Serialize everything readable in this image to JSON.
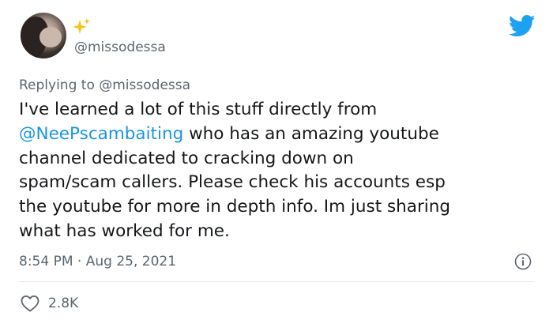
{
  "user": {
    "handle": "@missodessa"
  },
  "reply": {
    "prefix": "Replying to",
    "mention": "@missodessa"
  },
  "tweet": {
    "line1": "I've learned a lot of this stuff directly from",
    "line2_mention": "@NeePscambaiting",
    "line2_rest": " who has an amazing youtube",
    "line3": "channel dedicated to cracking down on",
    "line4": "spam/scam callers. Please check his accounts esp",
    "line5": "the youtube for more in depth info. Im just sharing",
    "line6": "what has worked for me."
  },
  "meta": {
    "time": "8:54 PM",
    "separator": " · ",
    "date": "Aug 25, 2021"
  },
  "likes": {
    "count": "2.8K"
  },
  "icons": {
    "twitter": "twitter-bird-icon",
    "sparkle": "sparkle-icon",
    "info": "info-icon",
    "heart": "heart-icon"
  },
  "colors": {
    "twitter_blue": "#1da1f2",
    "link_blue": "#1b95e0",
    "muted": "#5b6670",
    "text": "#14171a",
    "sparkle_yellow": "#f5c518",
    "divider": "#e1e8ed"
  }
}
